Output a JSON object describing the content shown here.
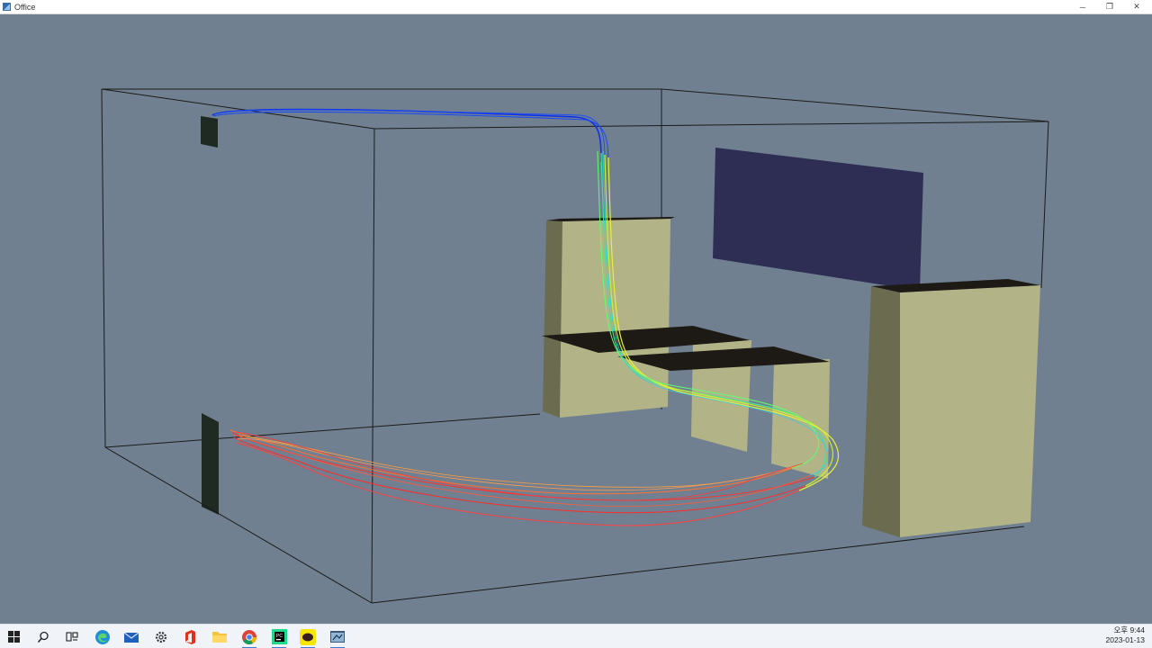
{
  "window": {
    "title": "Office",
    "controls": {
      "minimize": "─",
      "restore": "❐",
      "close": "✕"
    }
  },
  "scene": {
    "background": "#708090",
    "box_edge_color": "#1a1a1a",
    "object_color": "#b3b388",
    "object_shade_color": "#6b6b50",
    "panel_color": "#2e2e55",
    "vent_color": "#1f2a22",
    "desk_top_color": "#1d1a16"
  },
  "taskbar": {
    "apps": [
      {
        "name": "start",
        "icon": "windows-icon"
      },
      {
        "name": "search",
        "icon": "search-icon"
      },
      {
        "name": "task-view",
        "icon": "task-view-icon"
      },
      {
        "name": "edge",
        "icon": "edge-icon"
      },
      {
        "name": "mail",
        "icon": "mail-icon"
      },
      {
        "name": "settings",
        "icon": "gear-icon"
      },
      {
        "name": "office",
        "icon": "office-icon"
      },
      {
        "name": "explorer",
        "icon": "folder-icon"
      },
      {
        "name": "chrome",
        "icon": "chrome-icon"
      },
      {
        "name": "pycharm",
        "icon": "pycharm-icon"
      },
      {
        "name": "kakaotalk",
        "icon": "kakaotalk-icon"
      },
      {
        "name": "visualizer",
        "icon": "visualizer-icon"
      }
    ],
    "clock": {
      "time": "오후 9:44",
      "date": "2023-01-13"
    }
  }
}
